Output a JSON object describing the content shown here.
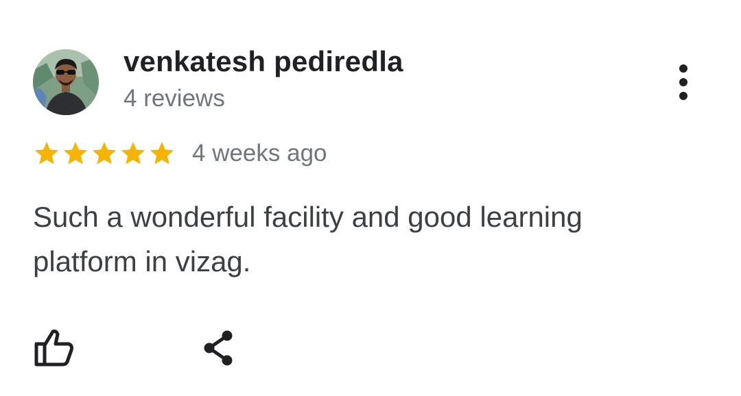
{
  "review": {
    "author": {
      "name": "venkatesh pediredla",
      "reviews_count": "4 reviews",
      "avatar": "profile-photo"
    },
    "rating": 5,
    "rating_max": 5,
    "time_ago": "4 weeks ago",
    "text": "Such a wonderful facility and good learning platform in vizag.",
    "icons": {
      "more": "more-vert-icon",
      "like": "thumbs-up-icon",
      "share": "share-icon",
      "star": "star-icon"
    },
    "colors": {
      "star": "#F5B400",
      "name": "#202124",
      "secondary_text": "#70757A",
      "body_text": "#3C4043",
      "icon": "#202124"
    }
  }
}
